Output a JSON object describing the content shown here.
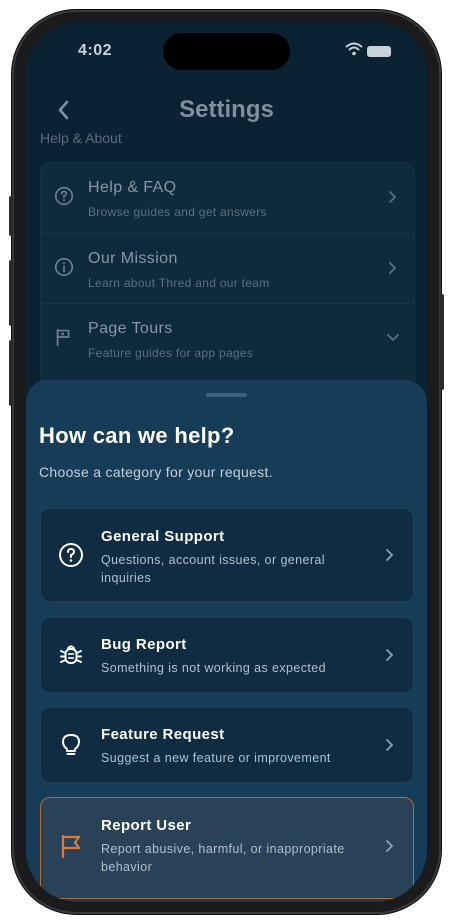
{
  "status_bar": {
    "time": "4:02"
  },
  "header": {
    "title": "Settings"
  },
  "settings": {
    "section_label": "Help & About",
    "items": [
      {
        "icon": "help-circle-icon",
        "title": "Help & FAQ",
        "subtitle": "Browse guides and get answers"
      },
      {
        "icon": "info-circle-icon",
        "title": "Our Mission",
        "subtitle": "Learn about Thred and our team"
      },
      {
        "icon": "tour-flag-icon",
        "title": "Page Tours",
        "subtitle": "Feature guides for app pages"
      }
    ]
  },
  "sheet": {
    "title": "How can we help?",
    "subtitle": "Choose a category for your request.",
    "categories": [
      {
        "icon": "help-circle-icon",
        "title": "General Support",
        "description": "Questions, account issues, or general inquiries"
      },
      {
        "icon": "bug-icon",
        "title": "Bug Report",
        "description": "Something is not working as expected"
      },
      {
        "icon": "lightbulb-icon",
        "title": "Feature Request",
        "description": "Suggest a new feature or improvement"
      },
      {
        "icon": "flag-icon",
        "title": "Report User",
        "description": "Report abusive, harmful, or inappropriate behavior"
      }
    ]
  },
  "colors": {
    "background": "#0b2233",
    "sheet": "#173c58",
    "card": "#0f2c42",
    "accent_orange": "#e07a3a"
  }
}
